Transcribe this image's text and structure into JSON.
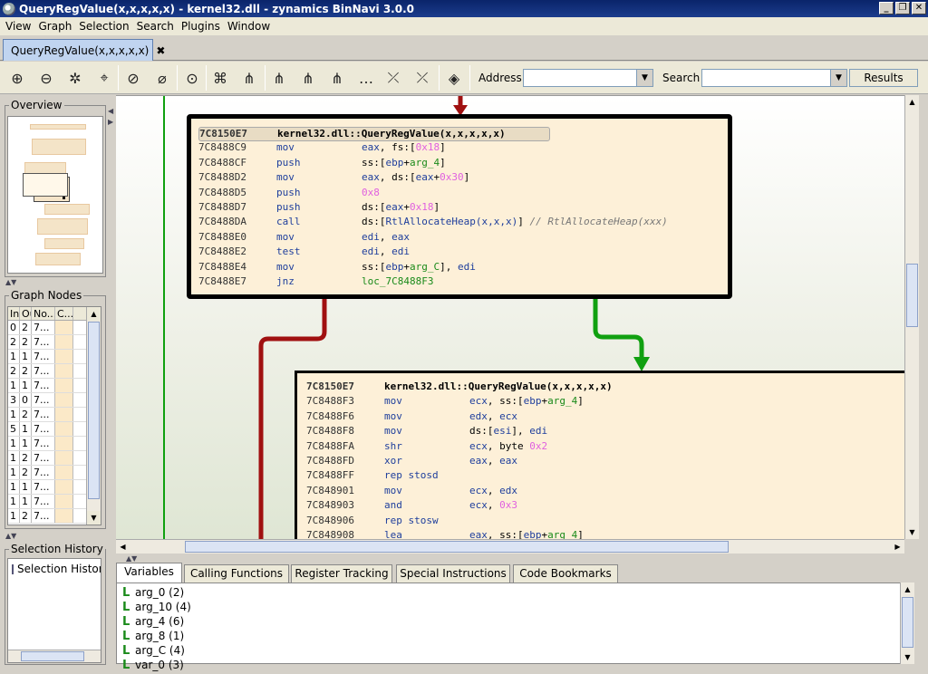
{
  "window": {
    "title": "QueryRegValue(x,x,x,x,x) - kernel32.dll - zynamics BinNavi 3.0.0",
    "buttons": [
      "_",
      "❐",
      "✕"
    ]
  },
  "menu": [
    "View",
    "Graph",
    "Selection",
    "Search",
    "Plugins",
    "Window"
  ],
  "doc_tab": {
    "label": "QueryRegValue(x,x,x,x,x)",
    "close": "✖"
  },
  "toolbar": {
    "address_label": "Address",
    "address_value": "",
    "search_label": "Search",
    "search_value": "",
    "results_label": "Results",
    "icons": [
      "zoom-in-icon",
      "zoom-out-icon",
      "zoom-fit-icon",
      "zoom-selection-icon",
      "cancel-zoom-icon",
      "freeze-icon",
      "center-icon",
      "hierarchic-layout-icon",
      "tree-layout-icon",
      "layout-1-icon",
      "layout-2-icon",
      "layout-3-icon",
      "expand-icon",
      "select-nodes-icon",
      "select-edges-icon",
      "color-fill-icon"
    ]
  },
  "overview": {
    "title": "Overview"
  },
  "graph_nodes": {
    "title": "Graph Nodes",
    "headers": [
      "In",
      "Out",
      "No...",
      "C..."
    ],
    "rows": [
      [
        "0",
        "2",
        "7...",
        ""
      ],
      [
        "2",
        "2",
        "7...",
        ""
      ],
      [
        "1",
        "1",
        "7...",
        ""
      ],
      [
        "2",
        "2",
        "7...",
        ""
      ],
      [
        "1",
        "1",
        "7...",
        ""
      ],
      [
        "3",
        "0",
        "7...",
        ""
      ],
      [
        "1",
        "2",
        "7...",
        ""
      ],
      [
        "5",
        "1",
        "7...",
        ""
      ],
      [
        "1",
        "1",
        "7...",
        ""
      ],
      [
        "1",
        "2",
        "7...",
        ""
      ],
      [
        "1",
        "2",
        "7...",
        ""
      ],
      [
        "1",
        "1",
        "7...",
        ""
      ],
      [
        "1",
        "1",
        "7...",
        ""
      ],
      [
        "1",
        "2",
        "7...",
        ""
      ]
    ]
  },
  "selection_history": {
    "title": "Selection History",
    "root": "Selection History"
  },
  "blocks": [
    {
      "header_addr": "7C8150E7",
      "header_name": "kernel32.dll::QueryRegValue(x,x,x,x,x)",
      "lines": [
        {
          "addr": "7C8488C9",
          "mn": "mov",
          "parts": [
            [
              "reg",
              "eax"
            ],
            [
              "",
              ", fs:["
            ],
            [
              "num",
              "0x18"
            ],
            [
              "",
              "]"
            ]
          ]
        },
        {
          "addr": "7C8488CF",
          "mn": "push",
          "parts": [
            [
              "",
              "ss:["
            ],
            [
              "reg",
              "ebp"
            ],
            [
              "",
              "+"
            ],
            [
              "var",
              "arg_4"
            ],
            [
              "",
              "]"
            ]
          ]
        },
        {
          "addr": "7C8488D2",
          "mn": "mov",
          "parts": [
            [
              "reg",
              "eax"
            ],
            [
              "",
              ", ds:["
            ],
            [
              "reg",
              "eax"
            ],
            [
              "",
              "+"
            ],
            [
              "num",
              "0x30"
            ],
            [
              "",
              "]"
            ]
          ]
        },
        {
          "addr": "7C8488D5",
          "mn": "push",
          "parts": [
            [
              "num",
              "0x8"
            ]
          ]
        },
        {
          "addr": "7C8488D7",
          "mn": "push",
          "parts": [
            [
              "",
              "ds:["
            ],
            [
              "reg",
              "eax"
            ],
            [
              "",
              "+"
            ],
            [
              "num",
              "0x18"
            ],
            [
              "",
              "]"
            ]
          ]
        },
        {
          "addr": "7C8488DA",
          "mn": "call",
          "parts": [
            [
              "",
              "ds:["
            ],
            [
              "fn",
              "RtlAllocateHeap(x,x,x)"
            ],
            [
              "",
              "] "
            ],
            [
              "cmt",
              "// RtlAllocateHeap(xxx)"
            ]
          ]
        },
        {
          "addr": "7C8488E0",
          "mn": "mov",
          "parts": [
            [
              "reg",
              "edi"
            ],
            [
              "",
              ", "
            ],
            [
              "reg",
              "eax"
            ]
          ]
        },
        {
          "addr": "7C8488E2",
          "mn": "test",
          "parts": [
            [
              "reg",
              "edi"
            ],
            [
              "",
              ", "
            ],
            [
              "reg",
              "edi"
            ]
          ]
        },
        {
          "addr": "7C8488E4",
          "mn": "mov",
          "parts": [
            [
              "",
              "ss:["
            ],
            [
              "reg",
              "ebp"
            ],
            [
              "",
              "+"
            ],
            [
              "var",
              "arg_C"
            ],
            [
              "",
              "], "
            ],
            [
              "reg",
              "edi"
            ]
          ]
        },
        {
          "addr": "7C8488E7",
          "mn": "jnz",
          "parts": [
            [
              "loc",
              "loc_7C8488F3"
            ]
          ]
        }
      ]
    },
    {
      "header_addr": "7C8150E7",
      "header_name": "kernel32.dll::QueryRegValue(x,x,x,x,x)",
      "lines": [
        {
          "addr": "7C8488F3",
          "mn": "mov",
          "parts": [
            [
              "reg",
              "ecx"
            ],
            [
              "",
              ", ss:["
            ],
            [
              "reg",
              "ebp"
            ],
            [
              "",
              "+"
            ],
            [
              "var",
              "arg_4"
            ],
            [
              "",
              "]"
            ]
          ]
        },
        {
          "addr": "7C8488F6",
          "mn": "mov",
          "parts": [
            [
              "reg",
              "edx"
            ],
            [
              "",
              ", "
            ],
            [
              "reg",
              "ecx"
            ]
          ]
        },
        {
          "addr": "7C8488F8",
          "mn": "mov",
          "parts": [
            [
              "",
              "ds:["
            ],
            [
              "reg",
              "esi"
            ],
            [
              "",
              "], "
            ],
            [
              "reg",
              "edi"
            ]
          ]
        },
        {
          "addr": "7C8488FA",
          "mn": "shr",
          "parts": [
            [
              "reg",
              "ecx"
            ],
            [
              "",
              ", byte "
            ],
            [
              "num",
              "0x2"
            ]
          ]
        },
        {
          "addr": "7C8488FD",
          "mn": "xor",
          "parts": [
            [
              "reg",
              "eax"
            ],
            [
              "",
              ", "
            ],
            [
              "reg",
              "eax"
            ]
          ]
        },
        {
          "addr": "7C8488FF",
          "mn": "rep stosd",
          "parts": []
        },
        {
          "addr": "7C848901",
          "mn": "mov",
          "parts": [
            [
              "reg",
              "ecx"
            ],
            [
              "",
              ", "
            ],
            [
              "reg",
              "edx"
            ]
          ]
        },
        {
          "addr": "7C848903",
          "mn": "and",
          "parts": [
            [
              "reg",
              "ecx"
            ],
            [
              "",
              ", "
            ],
            [
              "num",
              "0x3"
            ]
          ]
        },
        {
          "addr": "7C848906",
          "mn": "rep stosw",
          "parts": []
        },
        {
          "addr": "7C848908",
          "mn": "lea",
          "parts": [
            [
              "reg",
              "eax"
            ],
            [
              "",
              ", ss:["
            ],
            [
              "reg",
              "ebp"
            ],
            [
              "",
              "+"
            ],
            [
              "var",
              "arg_4"
            ],
            [
              "",
              "]"
            ]
          ]
        }
      ]
    }
  ],
  "bottom_tabs": [
    "Variables",
    "Calling Functions",
    "Register Tracking",
    "Special Instructions",
    "Code Bookmarks"
  ],
  "variables": [
    "arg_0 (2)",
    "arg_10 (4)",
    "arg_4 (6)",
    "arg_8 (1)",
    "arg_C (4)",
    "var_0 (3)"
  ],
  "colors": {
    "edge_false": "#a01010",
    "edge_true": "#10a010",
    "node_bg": "#fdf0d8",
    "selection": "#0a246a"
  }
}
